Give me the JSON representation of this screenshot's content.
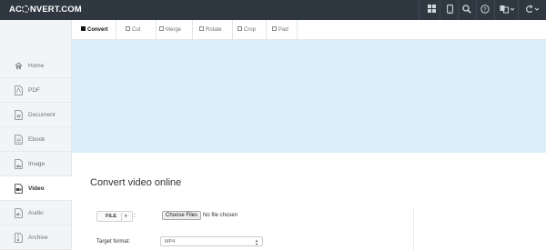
{
  "app": {
    "logo_left": "AC",
    "logo_right": "NVERT.COM"
  },
  "topbar": {
    "icons": [
      "grid-icon",
      "mobile-icon",
      "search-icon",
      "help-icon",
      "language-icon",
      "refresh-icon"
    ]
  },
  "sidebar": {
    "items": [
      {
        "label": "Home",
        "icon": "home-icon"
      },
      {
        "label": "PDF",
        "icon": "pdf-icon"
      },
      {
        "label": "Document",
        "icon": "document-icon"
      },
      {
        "label": "Ebook",
        "icon": "ebook-icon"
      },
      {
        "label": "Image",
        "icon": "image-icon"
      },
      {
        "label": "Video",
        "icon": "video-icon",
        "active": true
      },
      {
        "label": "Audio",
        "icon": "audio-icon"
      },
      {
        "label": "Archive",
        "icon": "archive-icon"
      }
    ]
  },
  "tabs": [
    {
      "label": "Convert",
      "active": true
    },
    {
      "label": "Cut"
    },
    {
      "label": "Merge"
    },
    {
      "label": "Rotate"
    },
    {
      "label": "Crop"
    },
    {
      "label": "Pad"
    }
  ],
  "main": {
    "heading": "Convert video online",
    "file_button": "FILE",
    "colon": ":",
    "choose_button": "Choose Files",
    "no_file": "No file chosen",
    "target_label": "Target format:",
    "target_value": "MP4"
  },
  "colors": {
    "topbar": "#2f3841",
    "banner": "#dbeef7",
    "sidebar": "#f3f4f5"
  }
}
